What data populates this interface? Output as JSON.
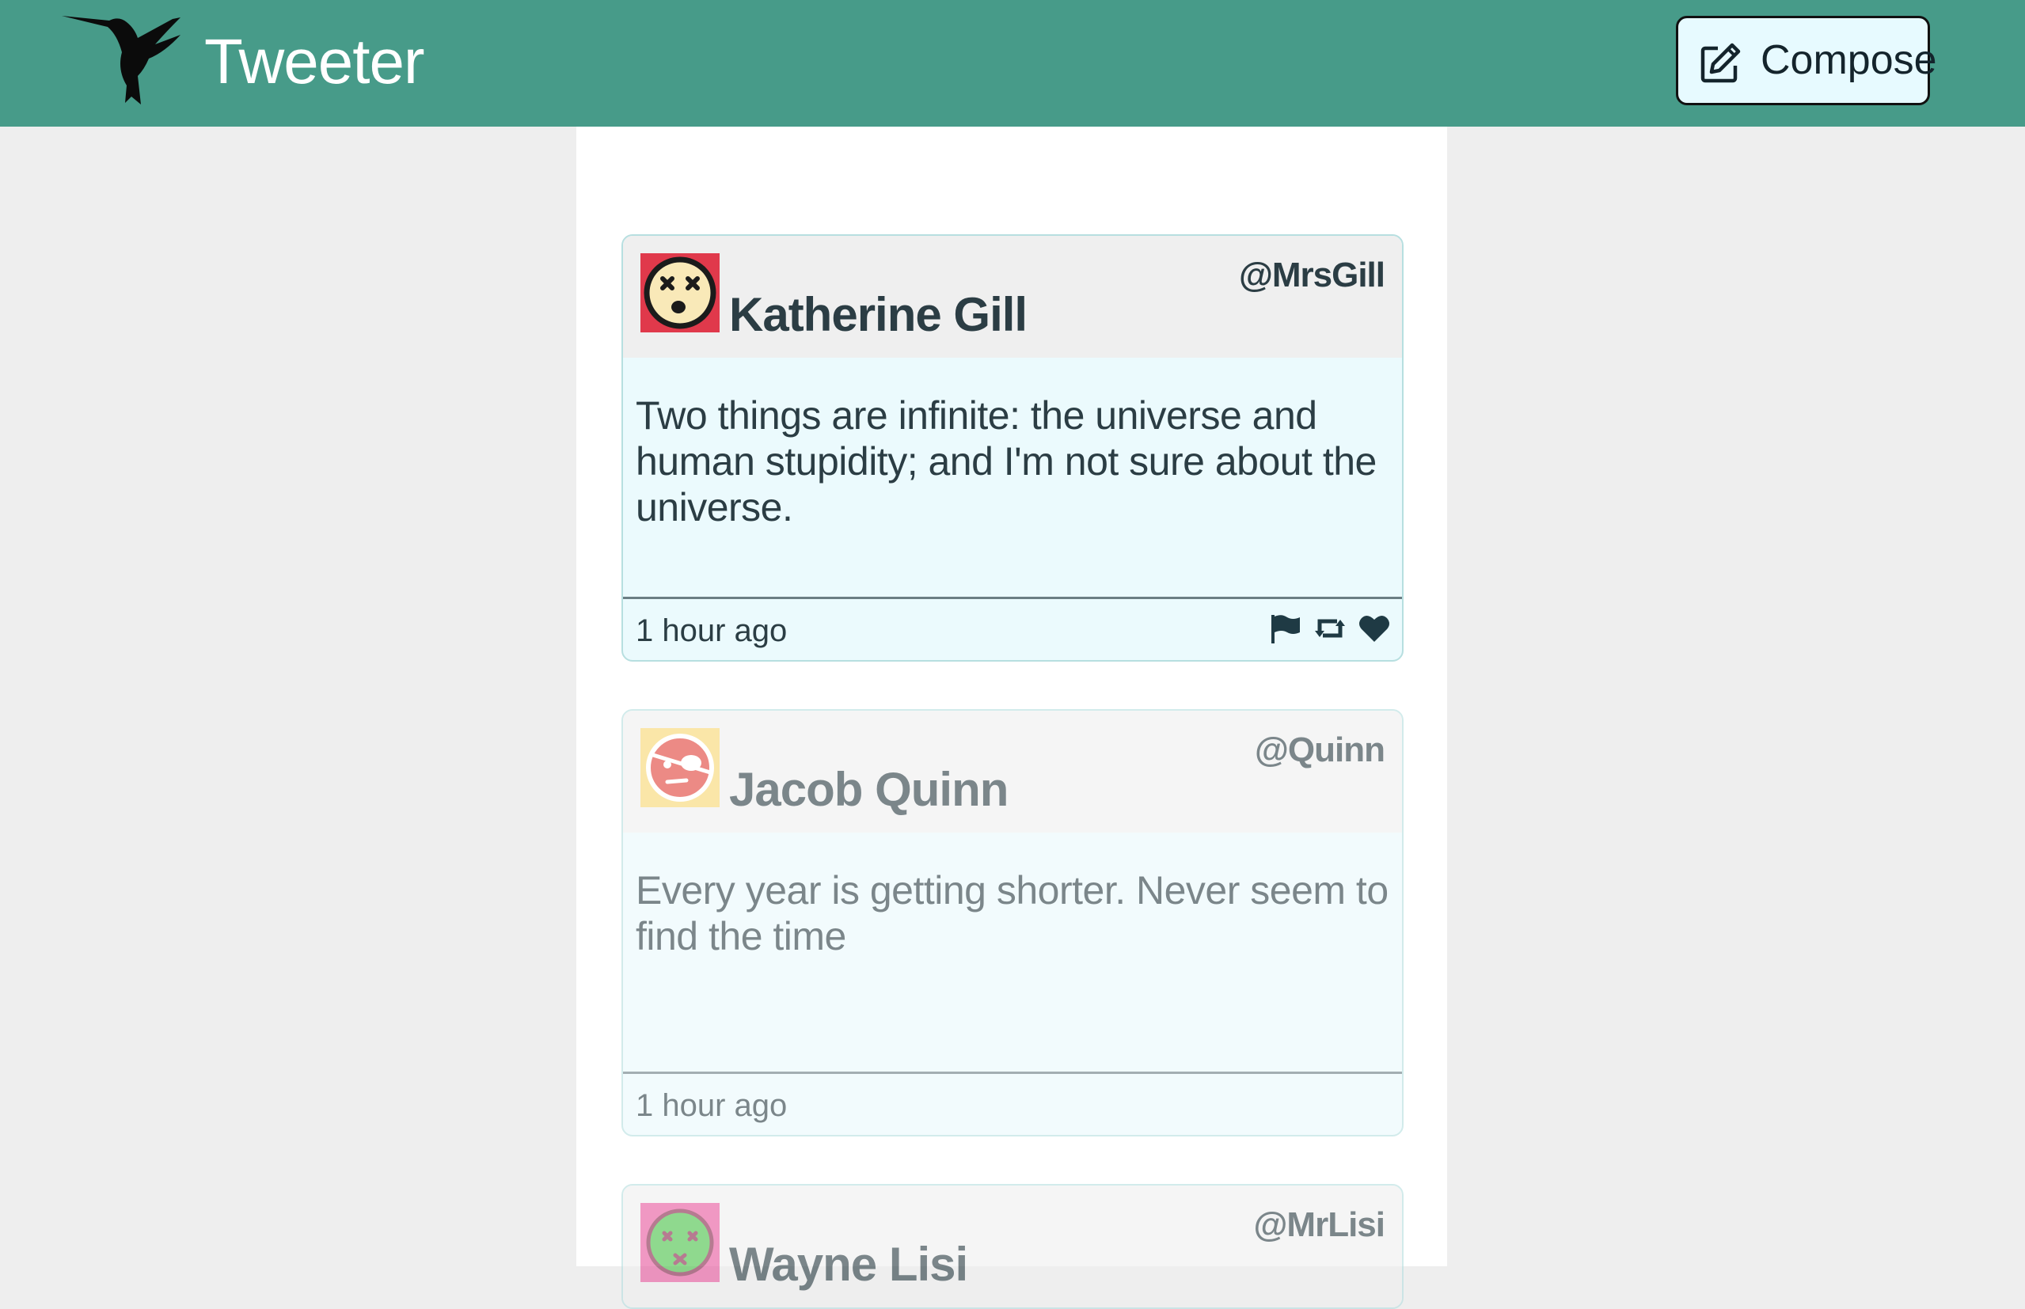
{
  "app": {
    "title": "Tweeter",
    "logo_icon": "hummingbird-logo",
    "compose_label": "Compose",
    "compose_icon": "edit-icon",
    "nav_color": "#479b89",
    "compose_bg": "#e7faff"
  },
  "tweets": [
    {
      "name": "Katherine Gill",
      "handle": "@MrsGill",
      "text": "Two things are infinite: the universe and human stupidity; and I'm not sure about the universe.",
      "time": "1 hour ago",
      "avatar_icon": "dizzy-face-icon",
      "avatar_bg": "#e0394b",
      "actions": [
        "flag-icon",
        "retweet-icon",
        "heart-icon"
      ]
    },
    {
      "name": "Jacob Quinn",
      "handle": "@Quinn",
      "text": "Every year is getting shorter. Never seem to find the time",
      "time": "1 hour ago",
      "avatar_icon": "pirate-face-icon",
      "avatar_bg": "#f8d774"
    },
    {
      "name": "Wayne Lisi",
      "handle": "@MrLisi",
      "avatar_icon": "sick-face-icon",
      "avatar_bg": "#e85aa0"
    }
  ]
}
